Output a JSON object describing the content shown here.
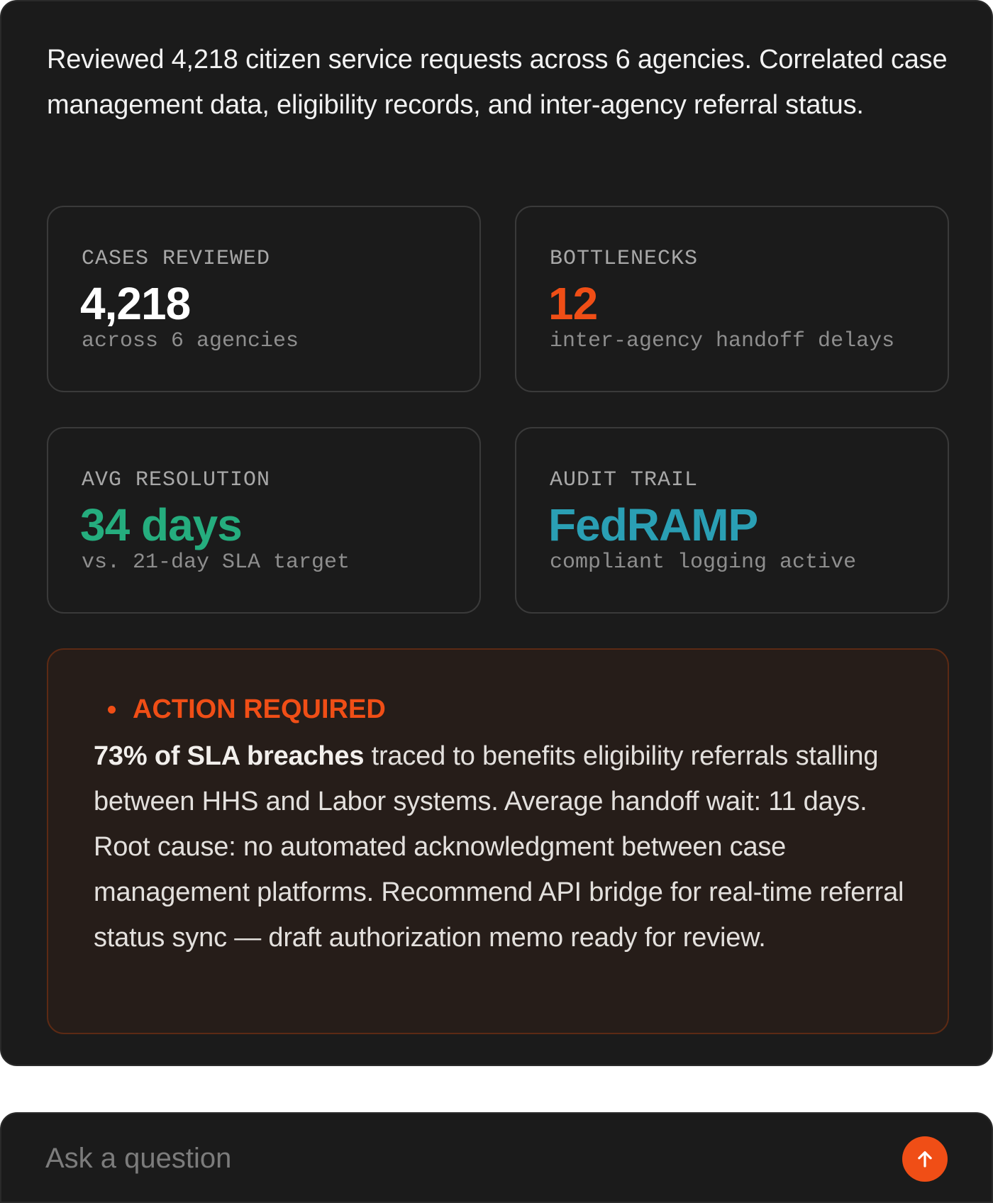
{
  "colors": {
    "background": "#1b1b1b",
    "primary_text": "#f2f2f2",
    "muted_text": "#8e8e8e",
    "accent_orange": "#f04e16",
    "accent_green": "#25ad7e",
    "accent_teal": "#2a9fb4",
    "alert_background": "#261d19",
    "alert_border": "#5c2a14"
  },
  "summary": {
    "text": "Reviewed 4,218 citizen service requests across 6 agencies. Correlated case management data, eligibility records, and inter-agency referral status."
  },
  "metrics": [
    {
      "label": "CASES REVIEWED",
      "value": "4,218",
      "sub": "across 6 agencies",
      "value_color": "#ffffff"
    },
    {
      "label": "BOTTLENECKS",
      "value": "12",
      "sub": "inter-agency handoff delays",
      "value_color": "#f04e16"
    },
    {
      "label": "AVG RESOLUTION",
      "value": "34 days",
      "sub": "vs. 21-day SLA target",
      "value_color": "#25ad7e"
    },
    {
      "label": "AUDIT TRAIL",
      "value": "FedRAMP",
      "sub": "compliant logging active",
      "value_color": "#2a9fb4"
    }
  ],
  "alert": {
    "title": "ACTION REQUIRED",
    "title_color": "#f04e16",
    "bold_lead": "73% of SLA breaches",
    "body": " traced to benefits eligibility referrals stalling between HHS and Labor systems. Average handoff wait: 11 days. Root cause: no automated acknowledgment between case management platforms. Recommend API bridge for real-time referral status sync — draft authorization memo ready for review."
  },
  "composer": {
    "placeholder": "Ask a question",
    "send_icon": "arrow-up-icon",
    "send_color": "#f04e16"
  }
}
